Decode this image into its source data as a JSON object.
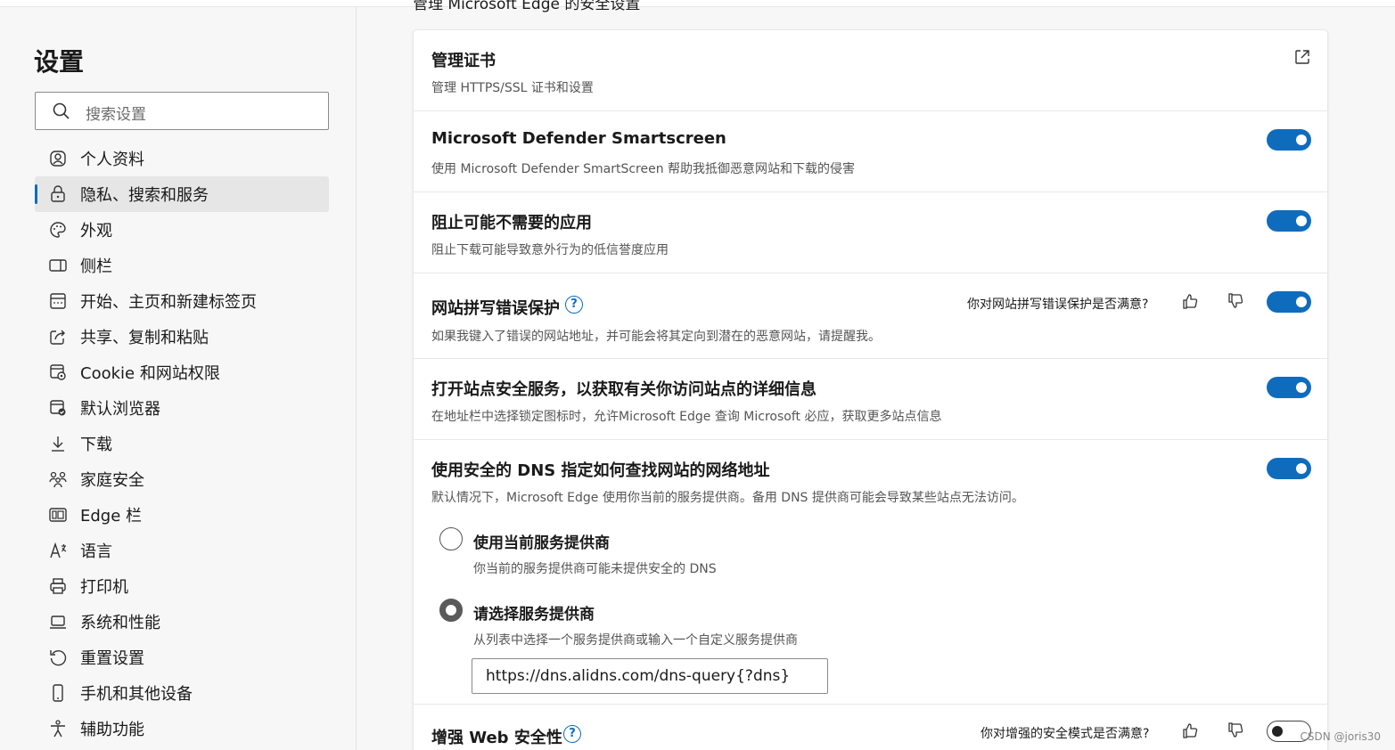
{
  "sidebar": {
    "title": "设置",
    "search_placeholder": "搜索设置",
    "items": [
      {
        "label": "个人资料",
        "icon": "profile-icon"
      },
      {
        "label": "隐私、搜索和服务",
        "icon": "lock-icon",
        "active": true
      },
      {
        "label": "外观",
        "icon": "palette-icon"
      },
      {
        "label": "侧栏",
        "icon": "sidebar-icon"
      },
      {
        "label": "开始、主页和新建标签页",
        "icon": "home-tab-icon"
      },
      {
        "label": "共享、复制和粘贴",
        "icon": "share-icon"
      },
      {
        "label": "Cookie 和网站权限",
        "icon": "cookie-icon"
      },
      {
        "label": "默认浏览器",
        "icon": "browser-icon"
      },
      {
        "label": "下载",
        "icon": "download-icon"
      },
      {
        "label": "家庭安全",
        "icon": "family-icon"
      },
      {
        "label": "Edge 栏",
        "icon": "edge-bar-icon"
      },
      {
        "label": "语言",
        "icon": "language-icon"
      },
      {
        "label": "打印机",
        "icon": "printer-icon"
      },
      {
        "label": "系统和性能",
        "icon": "laptop-icon"
      },
      {
        "label": "重置设置",
        "icon": "reset-icon"
      },
      {
        "label": "手机和其他设备",
        "icon": "phone-icon"
      },
      {
        "label": "辅助功能",
        "icon": "accessibility-icon"
      }
    ]
  },
  "main": {
    "section_heading": "管理 Microsoft Edge 的安全设置",
    "settings": {
      "certs": {
        "title": "管理证书",
        "desc": "管理 HTTPS/SSL 证书和设置"
      },
      "smartscreen": {
        "title": "Microsoft Defender Smartscreen",
        "desc": "使用 Microsoft Defender SmartScreen 帮助我抵御恶意网站和下载的侵害",
        "enabled": true
      },
      "pua": {
        "title": "阻止可能不需要的应用",
        "desc": "阻止下载可能导致意外行为的低信誉度应用",
        "enabled": true
      },
      "typo": {
        "title": "网站拼写错误保护",
        "desc": "如果我键入了错误的网站地址，并可能会将其定向到潜在的恶意网站，请提醒我。",
        "feedback": "你对网站拼写错误保护是否满意?",
        "enabled": true
      },
      "site_info": {
        "title": "打开站点安全服务，以获取有关你访问站点的详细信息",
        "desc": "在地址栏中选择锁定图标时，允许Microsoft Edge 查询 Microsoft 必应，获取更多站点信息",
        "enabled": true
      },
      "dns": {
        "title": "使用安全的 DNS 指定如何查找网站的网络地址",
        "desc": "默认情况下，Microsoft Edge 使用你当前的服务提供商。备用 DNS 提供商可能会导致某些站点无法访问。",
        "enabled": true,
        "option_current": {
          "title": "使用当前服务提供商",
          "desc": "你当前的服务提供商可能未提供安全的 DNS",
          "selected": false
        },
        "option_choose": {
          "title": "请选择服务提供商",
          "desc": "从列表中选择一个服务提供商或输入一个自定义服务提供商",
          "selected": true
        },
        "provider_value": "https://dns.alidns.com/dns-query{?dns}"
      },
      "enhanced": {
        "title": "增强 Web 安全性",
        "feedback": "你对增强的安全模式是否满意?",
        "enabled": false
      }
    }
  },
  "watermark": "CSDN @joris30",
  "colors": {
    "accent": "#0f6cbd",
    "active_bg": "#e6e6e6"
  }
}
